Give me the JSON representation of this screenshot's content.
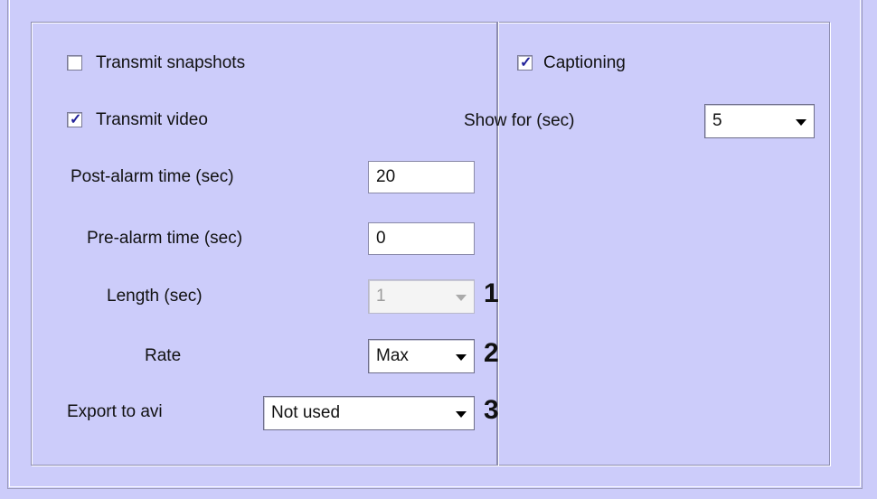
{
  "snapshots": {
    "label": "Transmit snapshots",
    "checked": false
  },
  "video": {
    "label": "Transmit video",
    "checked": true
  },
  "captioning": {
    "label": "Captioning",
    "checked": true
  },
  "show_for": {
    "label": "Show for (sec)",
    "value": "5"
  },
  "post_alarm": {
    "label": "Post-alarm time (sec)",
    "value": "20"
  },
  "pre_alarm": {
    "label": "Pre-alarm time (sec)",
    "value": "0"
  },
  "length": {
    "label": "Length (sec)",
    "value": "1",
    "disabled": true
  },
  "rate": {
    "label": "Rate",
    "value": "Max"
  },
  "export": {
    "label": "Export to avi",
    "value": "Not used"
  },
  "markers": [
    "1",
    "2",
    "3"
  ],
  "icons": {
    "check": "checkmark-icon",
    "dropdown": "chevron-down-icon"
  },
  "colors": {
    "background": "#ccccfa",
    "check_mark": "#22229a"
  }
}
